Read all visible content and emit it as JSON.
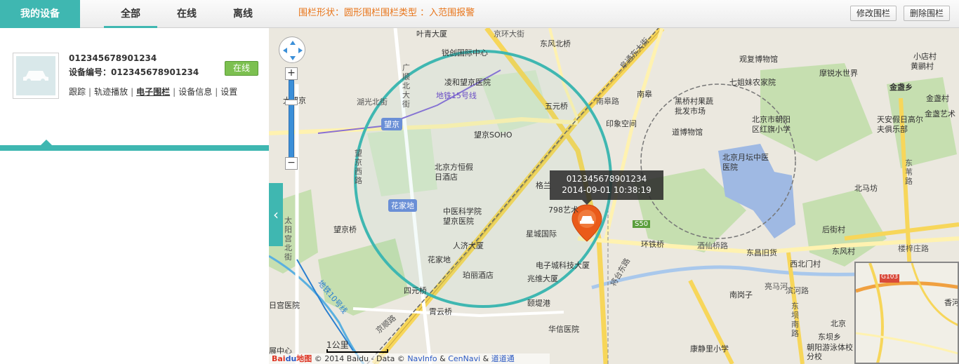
{
  "header": {
    "brand": "我的设备",
    "tabs": [
      "全部",
      "在线",
      "离线"
    ],
    "fence_info": "围栏形状：圆形围栏围栏类型 ：入范围报警",
    "edit_fence": "修改围栏",
    "delete_fence": "删除围栏"
  },
  "device": {
    "name": "012345678901234",
    "number": "设备编号：012345678901234",
    "status": "在线",
    "links": [
      "跟踪",
      "轨迹播放",
      "电子围栏",
      "设备信息",
      "设置"
    ]
  },
  "map": {
    "popup_id": "012345678901234",
    "popup_time": "2014-09-01 10:38:19",
    "scale": "1公里",
    "copyright": {
      "logo_bai": "Bai",
      "logo_du": "du",
      "logo_map": "地图",
      "text": "© 2014 Baidu - Data ©",
      "navinfo": "NavInfo",
      "amp1": "&",
      "cennavi": "CenNavi",
      "amp2": "&",
      "daodaotong": "道道通"
    },
    "labels": {
      "l1": "叶青大厦",
      "l2": "锐创国际中心",
      "l3": "凌和望京医院",
      "l4": "地铁15号线",
      "l5": "湖光北街",
      "l6": "望京",
      "l7": "望京SOHO",
      "l8": "北京方恒假日酒店",
      "l9": "花家地",
      "l10": "中医科学院望京医院",
      "l11": "人济大厦",
      "l12": "花家地",
      "l13": "珀丽酒店",
      "l14": "四元桥",
      "l15": "霄云桥",
      "l16": "望京桥",
      "l17": "阜通东大街",
      "l18": "五元桥",
      "l19": "南皋路",
      "l20": "印象空间",
      "l21": "格兰",
      "l22": "798艺术",
      "l23": "星城国际",
      "l24": "电子城科技大厦",
      "l25": "兆维大厦",
      "l26": "颐堤港",
      "l27": "华信医院",
      "l28": "S50",
      "l29": "环铁桥",
      "l30": "将台东路",
      "l31": "酒仙桥路",
      "l32": "东昌旧货",
      "l33": "南岗子",
      "l34": "滨河路",
      "l35": "东坝南路",
      "l36": "康静里小学",
      "l37": "朝阳游泳体校分校",
      "l38": "北京",
      "l39": "东坝乡",
      "l40": "观复博物馆",
      "l41": "七姐妹农家院",
      "l42": "黑桥村果蔬批发市场",
      "l43": "北京市朝阳区红旗小学",
      "l44": "道博物馆",
      "l45": "北京月坛中医医院",
      "l46": "摩锐水世界",
      "l47": "金盏乡",
      "l48": "天安假日高尔夫俱乐部",
      "l49": "东苇路",
      "l50": "北马坊",
      "l51": "后街村",
      "l52": "东风村",
      "l53": "楼梓庄路",
      "l54": "西北门村",
      "l55": "小店村",
      "l56": "黄鹂村",
      "l57": "金盏村",
      "l58": "金盏艺术",
      "l59": "南皋",
      "l60": "亮马河",
      "l61": "日宫医院",
      "l62": "地铁10号线",
      "l63": "广顺北大街",
      "l64": "东风北桥",
      "l65": "京环大街",
      "l66": "望京西路",
      "l67": "太阳宫北街",
      "l68": "京顺路",
      "l69": "G103",
      "l70": "香河",
      "l71": "东坝乡",
      "l72": "京包高速",
      "l73": "大望京",
      "l74": "展中心",
      "l75": "机场高速路"
    }
  }
}
